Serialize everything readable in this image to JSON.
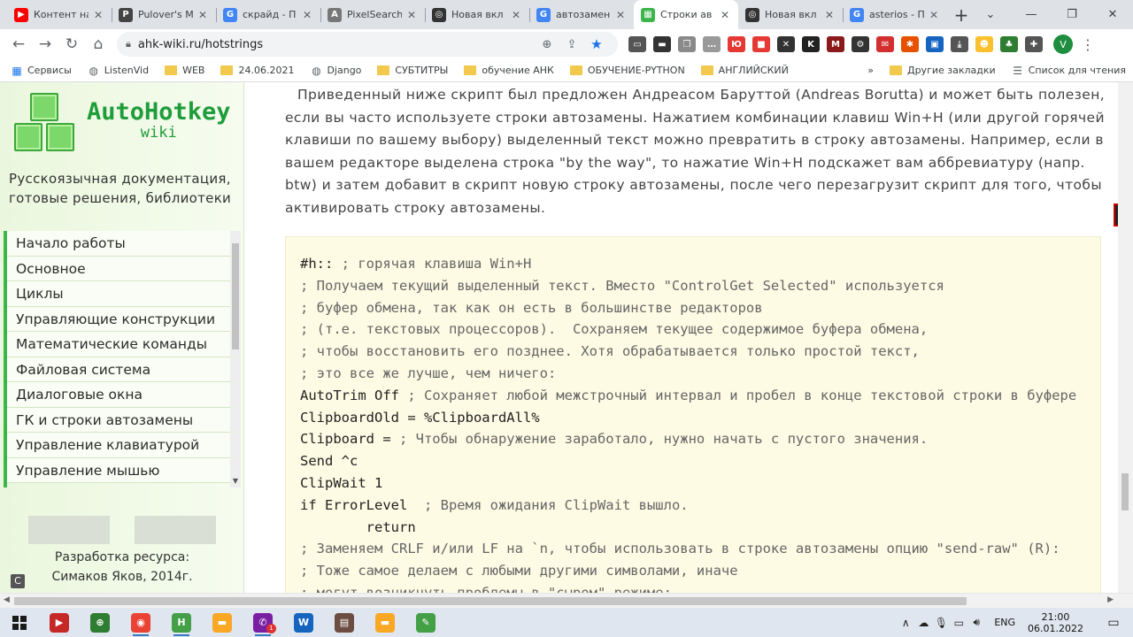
{
  "tabs": [
    {
      "title": "Контент на",
      "fav_color": "#ff0000",
      "fav_glyph": "▶",
      "active": false
    },
    {
      "title": "Pulover's M",
      "fav_color": "#444444",
      "fav_glyph": "P",
      "active": false
    },
    {
      "title": "скрайд - П",
      "fav_color": "#4285f4",
      "fav_glyph": "G",
      "active": false
    },
    {
      "title": "PixelSearch",
      "fav_color": "#777777",
      "fav_glyph": "A",
      "active": false
    },
    {
      "title": "Новая вкл",
      "fav_color": "#333333",
      "fav_glyph": "◎",
      "active": false
    },
    {
      "title": "автозамен",
      "fav_color": "#4285f4",
      "fav_glyph": "G",
      "active": false
    },
    {
      "title": "Строки ав",
      "fav_color": "#3cb54a",
      "fav_glyph": "▦",
      "active": true
    },
    {
      "title": "Новая вкл",
      "fav_color": "#333333",
      "fav_glyph": "◎",
      "active": false
    },
    {
      "title": "asterios - П",
      "fav_color": "#4285f4",
      "fav_glyph": "G",
      "active": false
    }
  ],
  "window_controls": [
    "⌄",
    "—",
    "❐",
    "✕"
  ],
  "toolbar": {
    "url": "ahk-wiki.ru/hotstrings",
    "avatar_letter": "V",
    "extensions": [
      {
        "name": "reader-icon",
        "color": "#555555",
        "glyph": "▭"
      },
      {
        "name": "folder-icon",
        "color": "#333333",
        "glyph": "▬"
      },
      {
        "name": "book-icon",
        "color": "#8a8a8a",
        "glyph": "❒"
      },
      {
        "name": "chat-icon",
        "color": "#999999",
        "glyph": "…"
      },
      {
        "name": "yandex-icon",
        "color": "#e53935",
        "glyph": "Ю"
      },
      {
        "name": "cube-icon",
        "color": "#e53935",
        "glyph": "■"
      },
      {
        "name": "x-icon",
        "color": "#333333",
        "glyph": "✕"
      },
      {
        "name": "k-icon",
        "color": "#222222",
        "glyph": "K"
      },
      {
        "name": "m-icon",
        "color": "#8b1a1a",
        "glyph": "M"
      },
      {
        "name": "gear-ext-icon",
        "color": "#333333",
        "glyph": "⚙"
      },
      {
        "name": "mail-icon",
        "color": "#d32f2f",
        "glyph": "✉"
      },
      {
        "name": "magic-icon",
        "color": "#e65100",
        "glyph": "✱"
      },
      {
        "name": "save-icon",
        "color": "#1565c0",
        "glyph": "▣"
      },
      {
        "name": "download-icon",
        "color": "#555555",
        "glyph": "⤓"
      },
      {
        "name": "smile-icon",
        "color": "#fbc02d",
        "glyph": "☻"
      },
      {
        "name": "leaf-icon",
        "color": "#2e7d32",
        "glyph": "♣"
      },
      {
        "name": "puzzle-icon",
        "color": "#555555",
        "glyph": "✚"
      }
    ]
  },
  "bookmarks": [
    {
      "label": "Сервисы",
      "kind": "grid"
    },
    {
      "label": "ListenVid",
      "kind": "globe"
    },
    {
      "label": "WEB",
      "kind": "folder"
    },
    {
      "label": "24.06.2021",
      "kind": "folder"
    },
    {
      "label": "Django",
      "kind": "globe"
    },
    {
      "label": "СУБТИТРЫ",
      "kind": "folder"
    },
    {
      "label": "обучение АНК",
      "kind": "folder"
    },
    {
      "label": "ОБУЧЕНИЕ-PYTHON",
      "kind": "folder"
    },
    {
      "label": "АНГЛИЙСКИЙ",
      "kind": "folder"
    }
  ],
  "bookmarks_right": {
    "more": "»",
    "other": "Другие закладки",
    "reading": "Список для чтения"
  },
  "sidebar": {
    "logo_title": "AutoHotkey",
    "logo_sub": "wiki",
    "tagline": "Русскоязычная документация, готовые решения, библиотеки",
    "nav": [
      "Начало работы",
      "Основное",
      "Циклы",
      "Управляющие конструкции",
      "Математические команды",
      "Файловая система",
      "Диалоговые окна",
      "ГК и строки автозамены",
      "Управление клавиатурой",
      "Управление мышью"
    ],
    "credit_line1": "Разработка ресурса:",
    "credit_line2": "Симаков Яков, 2014г."
  },
  "content": {
    "intro": "Приведенный ниже скрипт был предложен Андреасом Баруттой (Andreas Borutta) и может быть полезен, если вы часто используете строки автозамены. Нажатием комбинации клавиш Win+H (или другой горячей клавиши по вашему выбору) выделенный текст можно превратить в строку автозамены. Например, если в вашем редакторе выделена строка \"by the way\", то нажатие Win+H подскажет вам аббревиатуру (напр. btw) и затем добавит в скрипт новую строку автозамены, после чего перезагрузит скрипт для того, чтобы активировать строку автозамены.",
    "code": [
      {
        "code": "#h:: ",
        "comment": "; горячая клавиша Win+H"
      },
      {
        "code": "",
        "comment": "; Получаем текущий выделенный текст. Вместо \"ControlGet Selected\" используется"
      },
      {
        "code": "",
        "comment": "; буфер обмена, так как он есть в большинстве редакторов"
      },
      {
        "code": "",
        "comment": "; (т.е. текстовых процессоров).  Сохраняем текущее содержимое буфера обмена,"
      },
      {
        "code": "",
        "comment": "; чтобы восстановить его позднее. Хотя обрабатывается только простой текст,"
      },
      {
        "code": "",
        "comment": "; это все же лучше, чем ничего:"
      },
      {
        "code": "AutoTrim Off ",
        "comment": "; Сохраняет любой межстрочный интервал и пробел в конце текстовой строки в буфере"
      },
      {
        "code": "ClipboardOld = %ClipboardAll%",
        "comment": ""
      },
      {
        "code": "Clipboard = ",
        "comment": "; Чтобы обнаружение заработало, нужно начать с пустого значения."
      },
      {
        "code": "Send ^c",
        "comment": ""
      },
      {
        "code": "ClipWait 1",
        "comment": ""
      },
      {
        "code": "if ErrorLevel  ",
        "comment": "; Время ожидания ClipWait вышло."
      },
      {
        "code": "        return",
        "comment": ""
      },
      {
        "code": "",
        "comment": "; Заменяем CRLF и/или LF на `n, чтобы использовать в строке автозамены опцию \"send-raw\" (R):"
      },
      {
        "code": "",
        "comment": "; Тоже самое делаем с любыми другими символами, иначе"
      },
      {
        "code": "",
        "comment": "; могут возникнуть проблемы в \"сыром\" режиме:"
      }
    ]
  },
  "taskbar": {
    "apps": [
      {
        "name": "media-player-icon",
        "color": "#c62828",
        "glyph": "▶",
        "running": false
      },
      {
        "name": "xbox-icon",
        "color": "#2e7d32",
        "glyph": "⊕",
        "running": false
      },
      {
        "name": "chrome-icon",
        "color": "#ea4335",
        "glyph": "◉",
        "running": true
      },
      {
        "name": "ahk-h-icon",
        "color": "#43a047",
        "glyph": "H",
        "running": true
      },
      {
        "name": "explorer-icon",
        "color": "#f9a825",
        "glyph": "▬",
        "running": false
      },
      {
        "name": "viber-icon",
        "color": "#7b1fa2",
        "glyph": "✆",
        "running": true,
        "badge": "1"
      },
      {
        "name": "word-icon",
        "color": "#1565c0",
        "glyph": "W",
        "running": false
      },
      {
        "name": "archive-icon",
        "color": "#6d4c41",
        "glyph": "▤",
        "running": false
      },
      {
        "name": "folder-icon",
        "color": "#f9a825",
        "glyph": "▬",
        "running": false
      },
      {
        "name": "notepad-icon",
        "color": "#43a047",
        "glyph": "✎",
        "running": false
      }
    ],
    "lang": "ENG",
    "time": "21:00",
    "date": "06.01.2022"
  }
}
